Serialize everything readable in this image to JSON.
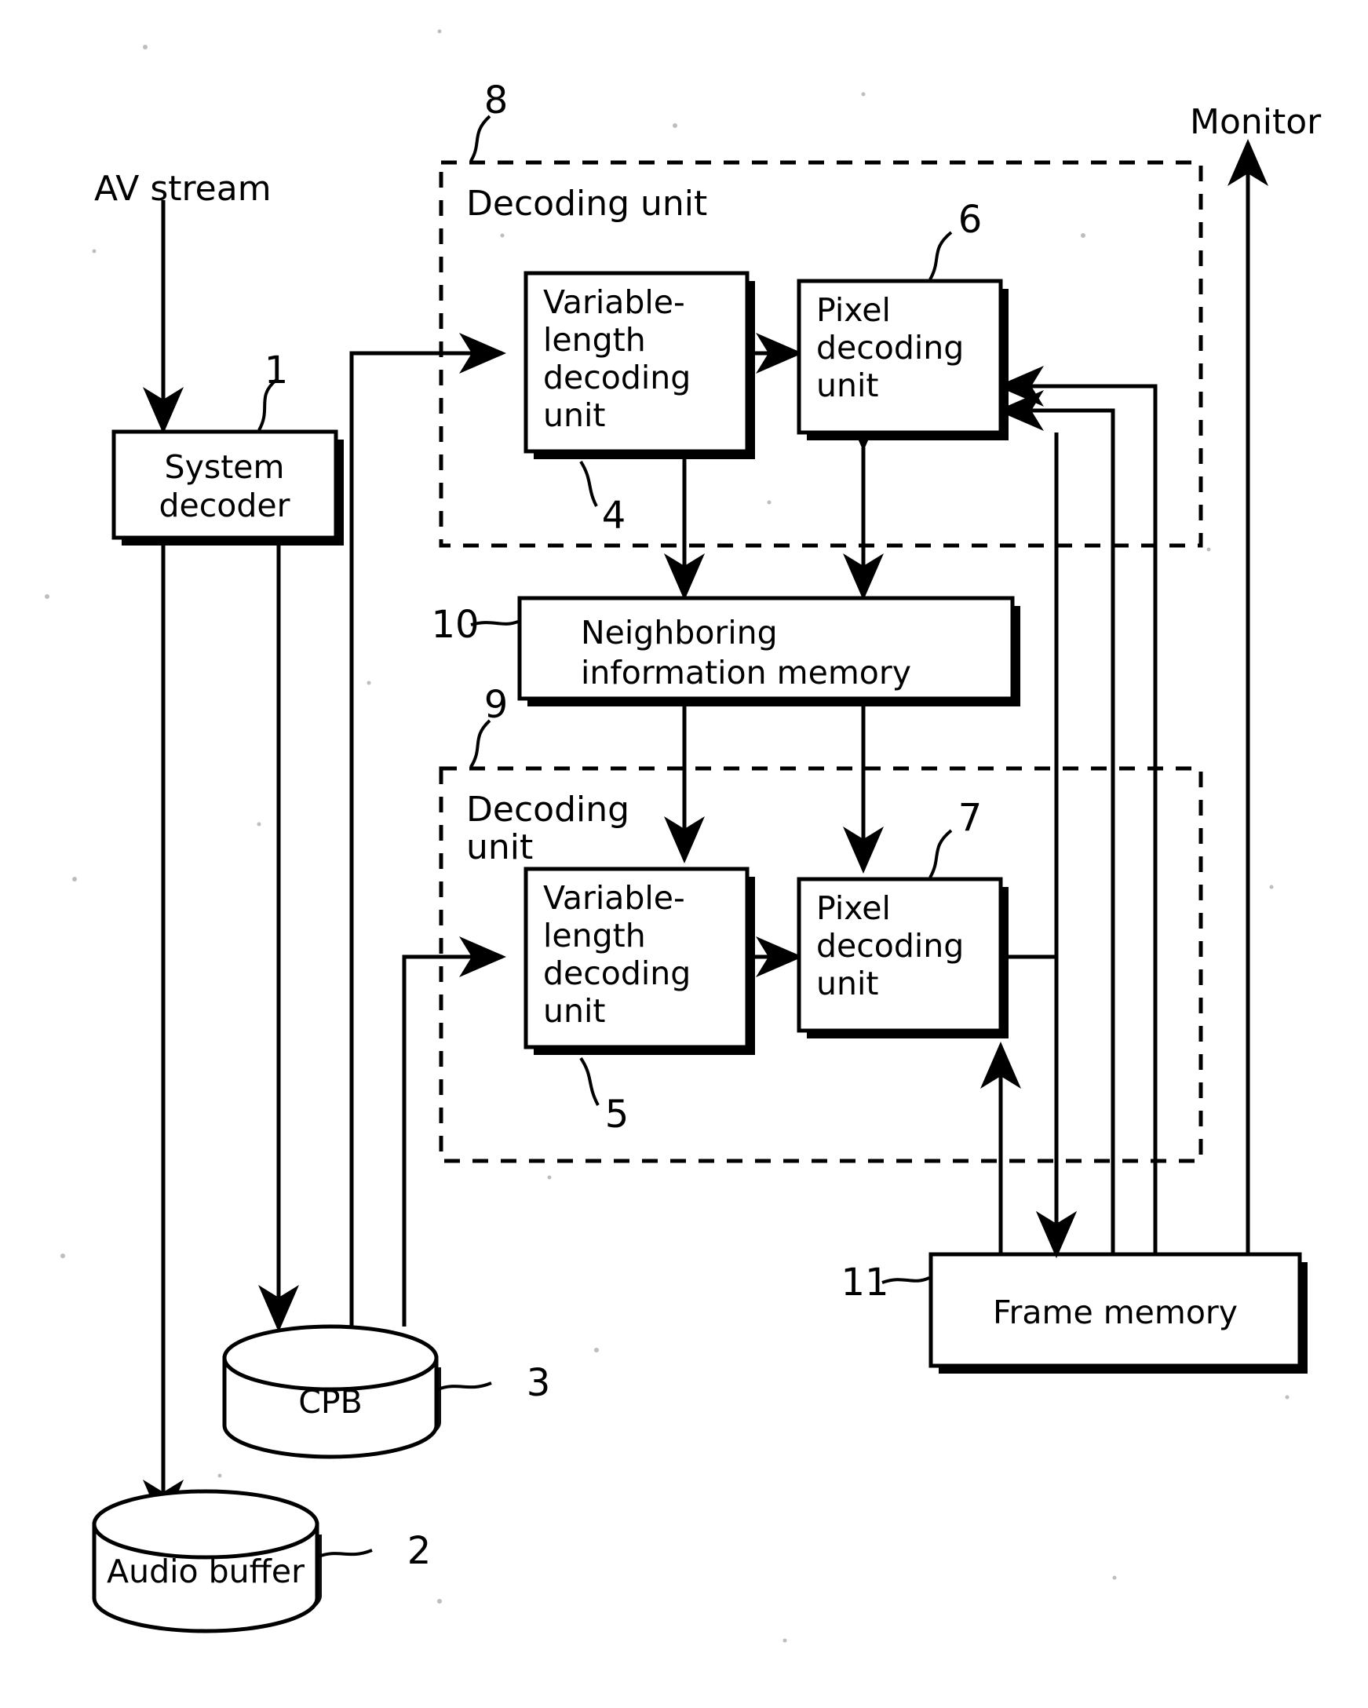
{
  "figure": {
    "title": "Video decoding apparatus block diagram",
    "kind": "patent-block-diagram"
  },
  "labels": {
    "av_stream": "AV stream",
    "monitor": "Monitor",
    "system_decoder": "System\ndecoder",
    "system_decoder_line1": "System",
    "system_decoder_line2": "decoder",
    "decoding_unit_8": "Decoding unit",
    "decoding_unit_9_line1": "Decoding",
    "decoding_unit_9_line2": "unit",
    "vld_line1": "Variable-",
    "vld_line2": "length",
    "vld_line3": "decoding",
    "vld_line4": "unit",
    "pixel_line1": "Pixel",
    "pixel_line2": "decoding",
    "pixel_line3": "unit",
    "neighboring_line1": "Neighboring",
    "neighboring_line2": "information memory",
    "cpb": "CPB",
    "audio_buffer": "Audio buffer",
    "frame_memory": "Frame memory"
  },
  "reference_numerals": {
    "system_decoder": "1",
    "audio_buffer": "2",
    "cpb": "3",
    "vld_upper": "4",
    "vld_lower": "5",
    "pixel_upper": "6",
    "pixel_lower": "7",
    "decoding_unit_upper": "8",
    "decoding_unit_lower": "9",
    "neighboring_memory": "10",
    "frame_memory": "11"
  },
  "blocks": [
    {
      "id": "system-decoder",
      "label": "System decoder",
      "ref": "1",
      "shape": "rect"
    },
    {
      "id": "decoding-unit-upper",
      "label": "Decoding unit",
      "ref": "8",
      "shape": "dashed-rect"
    },
    {
      "id": "vld-upper",
      "label": "Variable-length decoding unit",
      "ref": "4",
      "shape": "rect"
    },
    {
      "id": "pixel-upper",
      "label": "Pixel decoding unit",
      "ref": "6",
      "shape": "rect"
    },
    {
      "id": "neighboring-memory",
      "label": "Neighboring information memory",
      "ref": "10",
      "shape": "rect"
    },
    {
      "id": "decoding-unit-lower",
      "label": "Decoding unit",
      "ref": "9",
      "shape": "dashed-rect"
    },
    {
      "id": "vld-lower",
      "label": "Variable-length decoding unit",
      "ref": "5",
      "shape": "rect"
    },
    {
      "id": "pixel-lower",
      "label": "Pixel decoding unit",
      "ref": "7",
      "shape": "rect"
    },
    {
      "id": "cpb",
      "label": "CPB",
      "ref": "3",
      "shape": "cylinder"
    },
    {
      "id": "audio-buffer",
      "label": "Audio buffer",
      "ref": "2",
      "shape": "cylinder"
    },
    {
      "id": "frame-memory",
      "label": "Frame memory",
      "ref": "11",
      "shape": "rect"
    }
  ],
  "connections": [
    {
      "from": "AV stream",
      "to": "System decoder",
      "style": "arrow"
    },
    {
      "from": "System decoder",
      "to": "Audio buffer",
      "style": "arrow"
    },
    {
      "from": "System decoder",
      "to": "CPB",
      "style": "arrow"
    },
    {
      "from": "CPB",
      "to": "Variable-length decoding unit (4)",
      "style": "arrow"
    },
    {
      "from": "CPB",
      "to": "Variable-length decoding unit (5)",
      "style": "arrow"
    },
    {
      "from": "Variable-length decoding unit (4)",
      "to": "Pixel decoding unit (6)",
      "style": "arrow"
    },
    {
      "from": "Variable-length decoding unit (5)",
      "to": "Pixel decoding unit (7)",
      "style": "arrow"
    },
    {
      "from": "Variable-length decoding unit (4)",
      "to": "Neighboring information memory",
      "style": "double-arrow"
    },
    {
      "from": "Pixel decoding unit (6)",
      "to": "Neighboring information memory",
      "style": "double-arrow"
    },
    {
      "from": "Variable-length decoding unit (5)",
      "to": "Neighboring information memory",
      "style": "double-arrow"
    },
    {
      "from": "Pixel decoding unit (7)",
      "to": "Neighboring information memory",
      "style": "double-arrow"
    },
    {
      "from": "Pixel decoding unit (6)",
      "to": "Frame memory",
      "style": "arrow"
    },
    {
      "from": "Pixel decoding unit (7)",
      "to": "Frame memory",
      "style": "arrow"
    },
    {
      "from": "Frame memory",
      "to": "Pixel decoding unit (6)",
      "style": "arrow"
    },
    {
      "from": "Frame memory",
      "to": "Pixel decoding unit (7)",
      "style": "arrow"
    },
    {
      "from": "Frame memory",
      "to": "Monitor",
      "style": "arrow"
    }
  ],
  "colors": {
    "ink": "#000000",
    "paper": "#ffffff"
  }
}
